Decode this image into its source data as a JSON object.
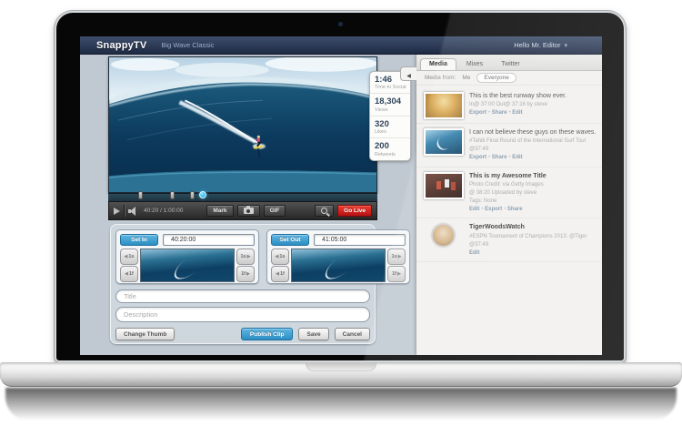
{
  "header": {
    "logo": "SnappyTV",
    "project_title": "Big Wave Classic",
    "user_menu": "Hello Mr. Editor"
  },
  "player": {
    "time_display": "40:20 / 1:00:00",
    "mark_button": "Mark",
    "gif_button": "GIF",
    "go_live_button": "Go Live"
  },
  "clip_editor": {
    "set_in_button": "Set In",
    "set_in_time": "40:20:00",
    "set_out_button": "Set Out",
    "set_out_time": "41:05:00",
    "step_second": "1s",
    "step_frame": "1f",
    "title_placeholder": "Title",
    "description_placeholder": "Description",
    "change_thumb_button": "Change Thumb",
    "publish_button": "Publish Clip",
    "save_button": "Save",
    "cancel_button": "Cancel"
  },
  "stats": [
    {
      "value": "1:46",
      "label": "Time to Social"
    },
    {
      "value": "18,304",
      "label": "Views"
    },
    {
      "value": "320",
      "label": "Likes"
    },
    {
      "value": "200",
      "label": "Retweets"
    }
  ],
  "media_panel": {
    "tabs": [
      {
        "label": "Media",
        "active": true
      },
      {
        "label": "Mixes",
        "active": false
      },
      {
        "label": "Twitter",
        "active": false
      }
    ],
    "filter_label": "Media from:",
    "filter_options": [
      "Me",
      "Everyone"
    ],
    "filter_selected": "Everyone",
    "items": [
      {
        "title": "This is the best runway show ever.",
        "lines": [
          "In@ 37:00 Out@ 37:16 by steve"
        ],
        "actions": [
          "Export",
          "Share",
          "Edit"
        ],
        "thumb": "runway-show-thumbnail"
      },
      {
        "title": "I can not believe these guys on these waves.",
        "lines": [
          "#Tahiti Final Round of the International Surf Tour",
          "@37:49"
        ],
        "actions": [
          "Export",
          "Share",
          "Edit"
        ],
        "thumb": "surf-wave-thumbnail"
      },
      {
        "title": "This is my Awesome Title",
        "lines": [
          "Photo Credit: via Getty Images",
          "@ 38:20 Uploaded by steve",
          "Tags: None"
        ],
        "actions": [
          "Edit",
          "Export",
          "Share"
        ],
        "thumb": "basketball-thumbnail"
      },
      {
        "title": "TigerWoodsWatch",
        "lines": [
          "#ESPN Tournament of Champions 2013: @Tiger",
          "@37:49"
        ],
        "actions": [
          "Edit"
        ],
        "thumb": "profile-avatar-thumbnail"
      }
    ]
  },
  "colors": {
    "header_navy": "#26334d",
    "accent_blue": "#2d8ec2",
    "live_red": "#c41414",
    "app_background": "#c0c9d2",
    "media_panel_background": "#f1f0ee"
  }
}
